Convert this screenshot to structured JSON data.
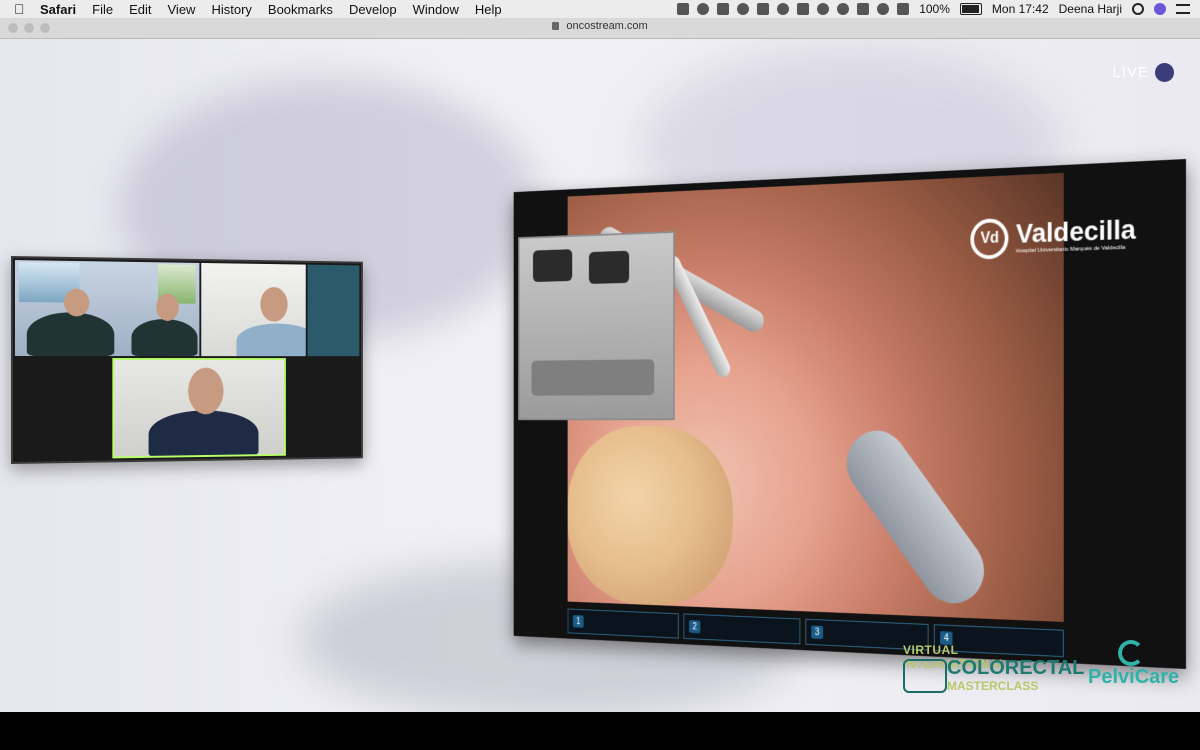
{
  "menubar": {
    "apple_icon": "apple-logo-icon",
    "items": [
      "Safari",
      "File",
      "Edit",
      "View",
      "History",
      "Bookmarks",
      "Develop",
      "Window",
      "Help"
    ],
    "battery_percent": "100%",
    "clock": "Mon 17:42",
    "user": "Deena Harji"
  },
  "browser": {
    "url": "oncostream.com"
  },
  "stream": {
    "live_label": "LIVE"
  },
  "hospital_logo": {
    "name": "Valdecilla",
    "subtitle": "Hospital Universitario Marqués de Valdecilla"
  },
  "video_steps": [
    {
      "num": "1",
      "label": ""
    },
    {
      "num": "2",
      "label": ""
    },
    {
      "num": "3",
      "label": ""
    },
    {
      "num": "4",
      "label": ""
    }
  ],
  "branding": {
    "line1": "VIRTUAL INTERNATIONAL",
    "line2": "COLORECTAL",
    "line3": "MASTERCLASS",
    "pelvicare": "PelviCare"
  },
  "colors": {
    "accent_teal": "#2fb2a8",
    "zoom_active_border": "#b7ff6b",
    "live_dot": "#3a3d7a"
  }
}
